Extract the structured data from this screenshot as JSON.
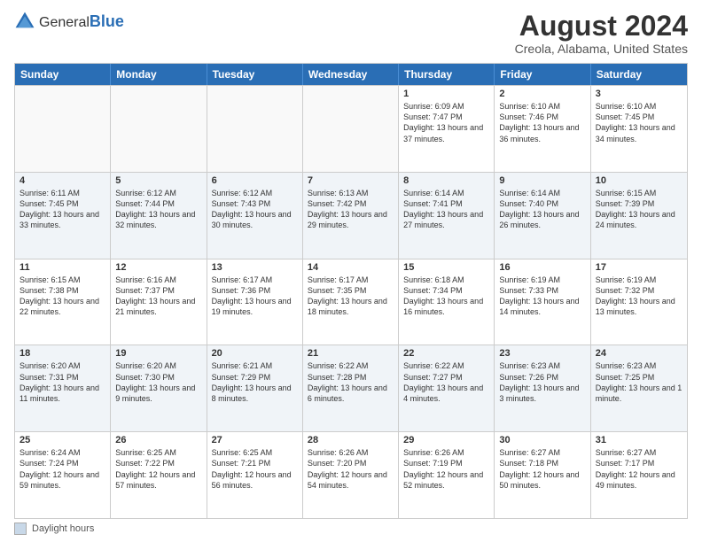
{
  "header": {
    "logo_general": "General",
    "logo_blue": "Blue",
    "main_title": "August 2024",
    "subtitle": "Creola, Alabama, United States"
  },
  "days_of_week": [
    "Sunday",
    "Monday",
    "Tuesday",
    "Wednesday",
    "Thursday",
    "Friday",
    "Saturday"
  ],
  "footer": {
    "legend_label": "Daylight hours"
  },
  "weeks": [
    [
      {
        "date": "",
        "info": ""
      },
      {
        "date": "",
        "info": ""
      },
      {
        "date": "",
        "info": ""
      },
      {
        "date": "",
        "info": ""
      },
      {
        "date": "1",
        "info": "Sunrise: 6:09 AM\nSunset: 7:47 PM\nDaylight: 13 hours and 37 minutes."
      },
      {
        "date": "2",
        "info": "Sunrise: 6:10 AM\nSunset: 7:46 PM\nDaylight: 13 hours and 36 minutes."
      },
      {
        "date": "3",
        "info": "Sunrise: 6:10 AM\nSunset: 7:45 PM\nDaylight: 13 hours and 34 minutes."
      }
    ],
    [
      {
        "date": "4",
        "info": "Sunrise: 6:11 AM\nSunset: 7:45 PM\nDaylight: 13 hours and 33 minutes."
      },
      {
        "date": "5",
        "info": "Sunrise: 6:12 AM\nSunset: 7:44 PM\nDaylight: 13 hours and 32 minutes."
      },
      {
        "date": "6",
        "info": "Sunrise: 6:12 AM\nSunset: 7:43 PM\nDaylight: 13 hours and 30 minutes."
      },
      {
        "date": "7",
        "info": "Sunrise: 6:13 AM\nSunset: 7:42 PM\nDaylight: 13 hours and 29 minutes."
      },
      {
        "date": "8",
        "info": "Sunrise: 6:14 AM\nSunset: 7:41 PM\nDaylight: 13 hours and 27 minutes."
      },
      {
        "date": "9",
        "info": "Sunrise: 6:14 AM\nSunset: 7:40 PM\nDaylight: 13 hours and 26 minutes."
      },
      {
        "date": "10",
        "info": "Sunrise: 6:15 AM\nSunset: 7:39 PM\nDaylight: 13 hours and 24 minutes."
      }
    ],
    [
      {
        "date": "11",
        "info": "Sunrise: 6:15 AM\nSunset: 7:38 PM\nDaylight: 13 hours and 22 minutes."
      },
      {
        "date": "12",
        "info": "Sunrise: 6:16 AM\nSunset: 7:37 PM\nDaylight: 13 hours and 21 minutes."
      },
      {
        "date": "13",
        "info": "Sunrise: 6:17 AM\nSunset: 7:36 PM\nDaylight: 13 hours and 19 minutes."
      },
      {
        "date": "14",
        "info": "Sunrise: 6:17 AM\nSunset: 7:35 PM\nDaylight: 13 hours and 18 minutes."
      },
      {
        "date": "15",
        "info": "Sunrise: 6:18 AM\nSunset: 7:34 PM\nDaylight: 13 hours and 16 minutes."
      },
      {
        "date": "16",
        "info": "Sunrise: 6:19 AM\nSunset: 7:33 PM\nDaylight: 13 hours and 14 minutes."
      },
      {
        "date": "17",
        "info": "Sunrise: 6:19 AM\nSunset: 7:32 PM\nDaylight: 13 hours and 13 minutes."
      }
    ],
    [
      {
        "date": "18",
        "info": "Sunrise: 6:20 AM\nSunset: 7:31 PM\nDaylight: 13 hours and 11 minutes."
      },
      {
        "date": "19",
        "info": "Sunrise: 6:20 AM\nSunset: 7:30 PM\nDaylight: 13 hours and 9 minutes."
      },
      {
        "date": "20",
        "info": "Sunrise: 6:21 AM\nSunset: 7:29 PM\nDaylight: 13 hours and 8 minutes."
      },
      {
        "date": "21",
        "info": "Sunrise: 6:22 AM\nSunset: 7:28 PM\nDaylight: 13 hours and 6 minutes."
      },
      {
        "date": "22",
        "info": "Sunrise: 6:22 AM\nSunset: 7:27 PM\nDaylight: 13 hours and 4 minutes."
      },
      {
        "date": "23",
        "info": "Sunrise: 6:23 AM\nSunset: 7:26 PM\nDaylight: 13 hours and 3 minutes."
      },
      {
        "date": "24",
        "info": "Sunrise: 6:23 AM\nSunset: 7:25 PM\nDaylight: 13 hours and 1 minute."
      }
    ],
    [
      {
        "date": "25",
        "info": "Sunrise: 6:24 AM\nSunset: 7:24 PM\nDaylight: 12 hours and 59 minutes."
      },
      {
        "date": "26",
        "info": "Sunrise: 6:25 AM\nSunset: 7:22 PM\nDaylight: 12 hours and 57 minutes."
      },
      {
        "date": "27",
        "info": "Sunrise: 6:25 AM\nSunset: 7:21 PM\nDaylight: 12 hours and 56 minutes."
      },
      {
        "date": "28",
        "info": "Sunrise: 6:26 AM\nSunset: 7:20 PM\nDaylight: 12 hours and 54 minutes."
      },
      {
        "date": "29",
        "info": "Sunrise: 6:26 AM\nSunset: 7:19 PM\nDaylight: 12 hours and 52 minutes."
      },
      {
        "date": "30",
        "info": "Sunrise: 6:27 AM\nSunset: 7:18 PM\nDaylight: 12 hours and 50 minutes."
      },
      {
        "date": "31",
        "info": "Sunrise: 6:27 AM\nSunset: 7:17 PM\nDaylight: 12 hours and 49 minutes."
      }
    ]
  ]
}
